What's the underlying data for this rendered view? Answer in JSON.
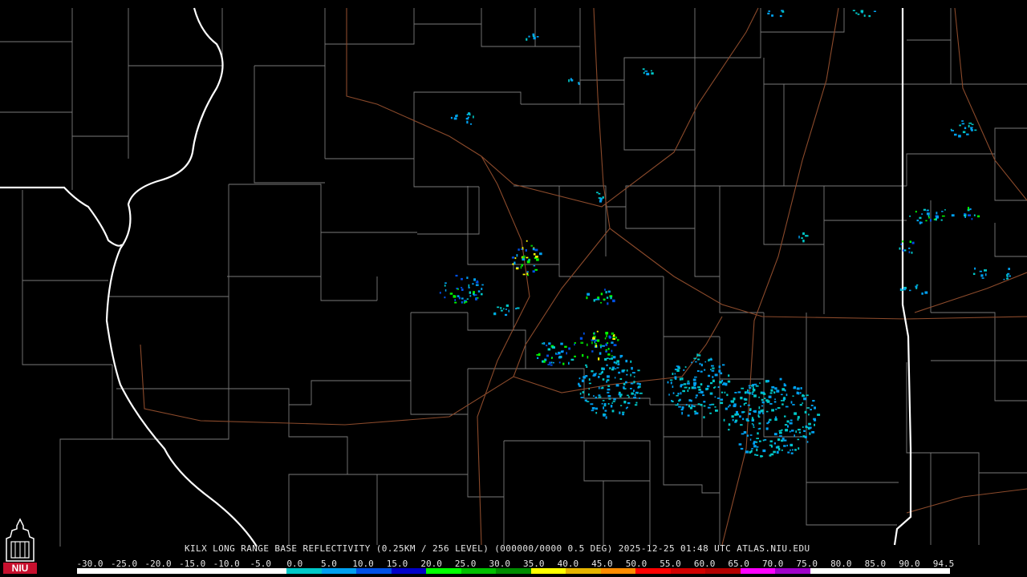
{
  "product_title": "KILX LONG RANGE BASE REFLECTIVITY (0.25KM / 256 LEVEL) (000000/0000 0.5 DEG) 2025-12-25 01:48 UTC  ATLAS.NIU.EDU",
  "logo": {
    "text": "NIU",
    "icon": "niu-tower-logo-icon",
    "color": "#c8102e"
  },
  "colors": {
    "background": "#000000",
    "county_lines": "#7a7a7a",
    "state_lines": "#ffffff",
    "highways": "#8b4a2b"
  },
  "scale": {
    "labels": [
      "-30.0",
      "-25.0",
      "-20.0",
      "-15.0",
      "-10.0",
      "-5.0",
      "0.0",
      "5.0",
      "10.0",
      "15.0",
      "20.0",
      "25.0",
      "30.0",
      "35.0",
      "40.0",
      "45.0",
      "50.0",
      "55.0",
      "60.0",
      "65.0",
      "70.0",
      "75.0",
      "80.0",
      "85.0",
      "90.0",
      "94.5"
    ],
    "colors": [
      "#000000",
      "#000000",
      "#000000",
      "#000000",
      "#000000",
      "#000000",
      "#00c8c8",
      "#00a0f0",
      "#0050e6",
      "#0000c8",
      "#00ff00",
      "#00c000",
      "#008c00",
      "#ffff00",
      "#e6b400",
      "#ff8c00",
      "#ff0000",
      "#d20000",
      "#b40000",
      "#ff00ff",
      "#a000c8",
      "#ffffff",
      "#ffffff",
      "#ffffff",
      "#ffffff"
    ]
  }
}
